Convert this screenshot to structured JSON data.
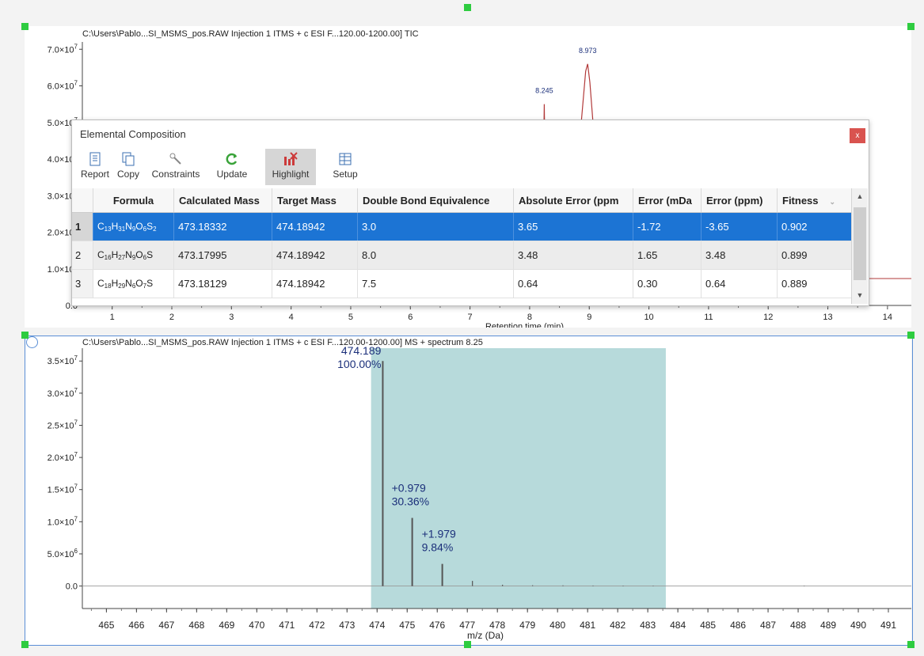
{
  "top_plot": {
    "title": "C:\\Users\\Pablo...SI_MSMS_pos.RAW Injection 1 ITMS + c ESI F...120.00-1200.00] TIC",
    "y_ticks": [
      {
        "mant": "7.0×10",
        "exp": "7"
      },
      {
        "mant": "6.0×10",
        "exp": "7"
      },
      {
        "mant": "5.0×10",
        "exp": "7"
      },
      {
        "mant": "4.0×10",
        "exp": "7"
      },
      {
        "mant": "3.0×10",
        "exp": "7"
      },
      {
        "mant": "2.0×10",
        "exp": "7"
      },
      {
        "mant": "1.0×10",
        "exp": "7"
      },
      {
        "mant": "0.0",
        "exp": ""
      }
    ],
    "x_ticks": [
      "1",
      "2",
      "3",
      "4",
      "5",
      "6",
      "7",
      "8",
      "9",
      "10",
      "11",
      "12",
      "13",
      "14"
    ],
    "xlabel": "Retention time (min)",
    "peak_labels": [
      {
        "rt": 8.245,
        "text": "8.245"
      },
      {
        "rt": 8.973,
        "text": "8.973"
      }
    ]
  },
  "bottom_plot": {
    "title": "C:\\Users\\Pablo...SI_MSMS_pos.RAW Injection 1 ITMS + c ESI F...120.00-1200.00] MS + spectrum 8.25",
    "y_ticks": [
      {
        "mant": "3.5×10",
        "exp": "7"
      },
      {
        "mant": "3.0×10",
        "exp": "7"
      },
      {
        "mant": "2.5×10",
        "exp": "7"
      },
      {
        "mant": "2.0×10",
        "exp": "7"
      },
      {
        "mant": "1.5×10",
        "exp": "7"
      },
      {
        "mant": "1.0×10",
        "exp": "7"
      },
      {
        "mant": "5.0×10",
        "exp": "6"
      },
      {
        "mant": "0.0",
        "exp": ""
      }
    ],
    "x_ticks": [
      "465",
      "466",
      "467",
      "468",
      "469",
      "470",
      "471",
      "472",
      "473",
      "474",
      "475",
      "476",
      "477",
      "478",
      "479",
      "480",
      "481",
      "482",
      "483",
      "484",
      "485",
      "486",
      "487",
      "488",
      "489",
      "490",
      "491"
    ],
    "xlabel": "m/z (Da)",
    "annotations": [
      {
        "line1": "474.189",
        "line2": "100.00%"
      },
      {
        "line1": "+0.979",
        "line2": "30.36%"
      },
      {
        "line1": "+1.979",
        "line2": "9.84%"
      }
    ]
  },
  "chart_data": [
    {
      "type": "line",
      "title": "C:\\Users\\Pablo...SI_MSMS_pos.RAW Injection 1 ITMS + c ESI F...120.00-1200.00] TIC",
      "xlabel": "Retention time (min)",
      "ylabel": "",
      "xlim": [
        0.5,
        14.4
      ],
      "ylim": [
        0,
        72000000
      ],
      "series": [
        {
          "x": [
            7.9,
            8.2,
            8.245,
            8.29,
            8.6,
            8.94,
            8.973,
            9.01,
            9.3
          ],
          "y": [
            0,
            0,
            55000000,
            0,
            0,
            64000000,
            66000000,
            61000000,
            0
          ]
        }
      ],
      "grid": false
    },
    {
      "type": "bar",
      "title": "C:\\Users\\Pablo...SI_MSMS_pos.RAW Injection 1 ITMS + c ESI F...120.00-1200.00] MS + spectrum 8.25",
      "xlabel": "m/z (Da)",
      "ylabel": "",
      "xlim": [
        464.2,
        491.5
      ],
      "ylim": [
        -3500000,
        37000000
      ],
      "x": [
        474.189,
        475.168,
        476.168,
        477.17,
        478.17,
        479.17,
        480.18,
        481.18,
        482.18,
        483.18,
        488.2
      ],
      "values": [
        35000000,
        10600000,
        3440000,
        800000,
        200000,
        120000,
        100000,
        80000,
        70000,
        60000,
        60000
      ],
      "highlight_range": [
        473.8,
        483.6
      ],
      "grid": false
    }
  ],
  "dialog": {
    "title": "Elemental Composition",
    "close_label": "x",
    "toolbar": [
      {
        "label": "Report",
        "icon": "report-icon"
      },
      {
        "label": "Copy",
        "icon": "copy-icon"
      },
      {
        "label": "Constraints",
        "icon": "constraints-icon"
      },
      {
        "label": "Update",
        "icon": "update-icon"
      },
      {
        "label": "Highlight",
        "icon": "highlight-icon"
      },
      {
        "label": "Setup",
        "icon": "setup-icon"
      }
    ],
    "columns": [
      "Formula",
      "Calculated Mass",
      "Target Mass",
      "Double Bond Equivalence",
      "Absolute Error (ppm",
      "Error (mDa",
      "Error (ppm)",
      "Fitness"
    ],
    "rows": [
      {
        "num": "1",
        "formula": [
          [
            "C",
            "13"
          ],
          [
            "H",
            "31"
          ],
          [
            "N",
            "9"
          ],
          [
            "O",
            "6"
          ],
          [
            "S",
            "2"
          ]
        ],
        "calc": "473.18332",
        "target": "474.18942",
        "dbe": "3.0",
        "abs_err": "3.65",
        "err_mda": "-1.72",
        "err_ppm": "-3.65",
        "fitness": "0.902"
      },
      {
        "num": "2",
        "formula": [
          [
            "C",
            "16"
          ],
          [
            "H",
            "27"
          ],
          [
            "N",
            "9"
          ],
          [
            "O",
            "6"
          ],
          [
            "S",
            ""
          ]
        ],
        "calc": "473.17995",
        "target": "474.18942",
        "dbe": "8.0",
        "abs_err": "3.48",
        "err_mda": "1.65",
        "err_ppm": "3.48",
        "fitness": "0.899"
      },
      {
        "num": "3",
        "formula": [
          [
            "C",
            "18"
          ],
          [
            "H",
            "29"
          ],
          [
            "N",
            "6"
          ],
          [
            "O",
            "7"
          ],
          [
            "S",
            ""
          ]
        ],
        "calc": "473.18129",
        "target": "474.18942",
        "dbe": "7.5",
        "abs_err": "0.64",
        "err_mda": "0.30",
        "err_ppm": "0.64",
        "fitness": "0.889"
      }
    ],
    "selected_row": 0,
    "active_tool": "Highlight",
    "accent_color": "#1c74d4"
  }
}
